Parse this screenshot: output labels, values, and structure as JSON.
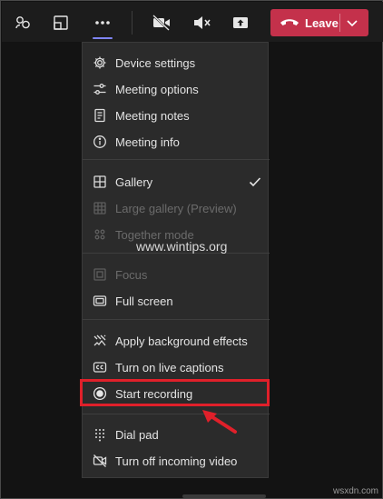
{
  "toolbar": {
    "buttons": [
      {
        "name": "people",
        "icon": "people-icon"
      },
      {
        "name": "share-tray",
        "icon": "share-tray-icon"
      },
      {
        "name": "more-actions",
        "icon": "more-icon"
      },
      {
        "name": "camera",
        "icon": "camera-off-icon"
      },
      {
        "name": "mic",
        "icon": "mic-muted-icon"
      },
      {
        "name": "share",
        "icon": "share-screen-icon"
      }
    ],
    "leave_label": "Leave",
    "leave_color": "#c4314b"
  },
  "menu": {
    "groups": [
      {
        "items": [
          {
            "label": "Device settings",
            "icon": "gear-icon",
            "disabled": false
          },
          {
            "label": "Meeting options",
            "icon": "sliders-icon",
            "disabled": false
          },
          {
            "label": "Meeting notes",
            "icon": "notes-icon",
            "disabled": false
          },
          {
            "label": "Meeting info",
            "icon": "info-icon",
            "disabled": false
          }
        ]
      },
      {
        "items": [
          {
            "label": "Gallery",
            "icon": "gallery-icon",
            "disabled": false,
            "checked": true
          },
          {
            "label": "Large gallery (Preview)",
            "icon": "large-gallery-icon",
            "disabled": true
          },
          {
            "label": "Together mode",
            "icon": "together-mode-icon",
            "disabled": true
          }
        ]
      },
      {
        "items": [
          {
            "label": "Focus",
            "icon": "focus-icon",
            "disabled": true
          },
          {
            "label": "Full screen",
            "icon": "fullscreen-icon",
            "disabled": false
          }
        ]
      },
      {
        "items": [
          {
            "label": "Apply background effects",
            "icon": "background-effects-icon",
            "disabled": false
          },
          {
            "label": "Turn on live captions",
            "icon": "captions-icon",
            "disabled": false
          },
          {
            "label": "Start recording",
            "icon": "record-icon",
            "disabled": false,
            "highlighted": true
          }
        ]
      },
      {
        "items": [
          {
            "label": "Dial pad",
            "icon": "dialpad-icon",
            "disabled": false
          },
          {
            "label": "Turn off incoming video",
            "icon": "video-off-icon",
            "disabled": false
          }
        ]
      }
    ]
  },
  "watermark": "www.wintips.org",
  "watermark2": "wsxdn.com",
  "colors": {
    "accent": "#7f85f5",
    "highlight_box": "#e0202a",
    "menu_bg": "#2b2b2b"
  }
}
